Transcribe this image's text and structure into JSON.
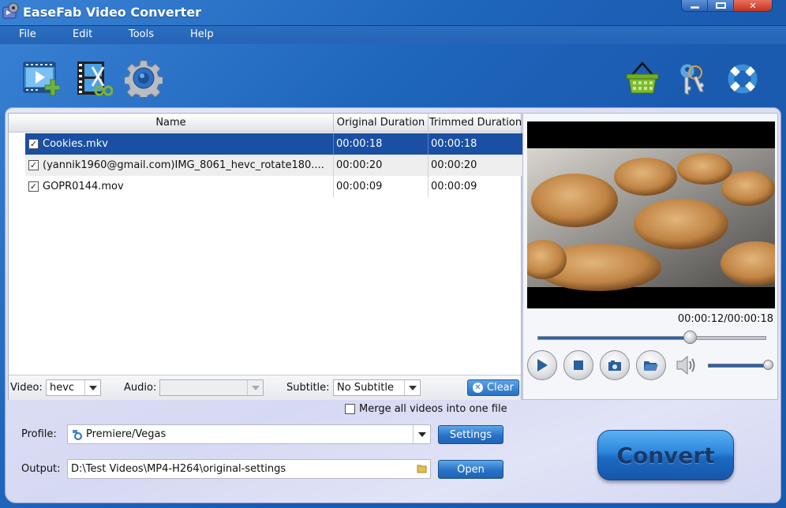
{
  "window": {
    "title": "EaseFab Video Converter",
    "controls": {
      "minimize": "minimize",
      "maximize": "maximize",
      "close": "✕"
    }
  },
  "menu": [
    "File",
    "Edit",
    "Tools",
    "Help"
  ],
  "toolbar": {
    "left": [
      {
        "name": "add-video",
        "icon": "film-plus-icon"
      },
      {
        "name": "edit-video",
        "icon": "film-scissors-icon"
      },
      {
        "name": "settings",
        "icon": "gear-icon"
      }
    ],
    "right": [
      {
        "name": "buy",
        "icon": "basket-icon"
      },
      {
        "name": "register",
        "icon": "keys-icon"
      },
      {
        "name": "help",
        "icon": "lifebuoy-icon"
      }
    ]
  },
  "file_list": {
    "columns": [
      "Name",
      "Original Duration",
      "Trimmed Duration"
    ],
    "rows": [
      {
        "checked": true,
        "name": "Cookies.mkv",
        "original": "00:00:18",
        "trimmed": "00:00:18",
        "selected": true
      },
      {
        "checked": true,
        "name": "(yannik1960@gmail.com)IMG_8061_hevc_rotate180....",
        "original": "00:00:20",
        "trimmed": "00:00:20",
        "selected": false
      },
      {
        "checked": true,
        "name": "GOPR0144.mov",
        "original": "00:00:09",
        "trimmed": "00:00:09",
        "selected": false
      }
    ],
    "check_glyph": "✓"
  },
  "tracks": {
    "video_label": "Video:",
    "video_value": "hevc",
    "audio_label": "Audio:",
    "audio_value": "",
    "subtitle_label": "Subtitle:",
    "subtitle_value": "No Subtitle",
    "clear_label": "Clear"
  },
  "preview": {
    "time": "00:00:12/00:00:18",
    "progress": 0.667,
    "volume": 1.0
  },
  "merge": {
    "label": "Merge all videos into one file",
    "checked": false
  },
  "profile": {
    "label": "Profile:",
    "value": "Premiere/Vegas",
    "settings_label": "Settings"
  },
  "output": {
    "label": "Output:",
    "value": "D:\\Test Videos\\MP4-H264\\original-settings",
    "open_label": "Open"
  },
  "convert_label": "Convert",
  "colors": {
    "accent": "#1a4fa3",
    "window": "#1f66bd",
    "panel": "#dcdff4"
  }
}
